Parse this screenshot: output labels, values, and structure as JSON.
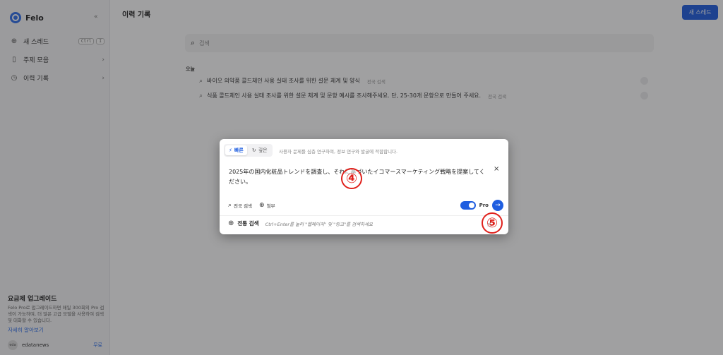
{
  "sidebar": {
    "logo": "Felo",
    "collapse_icon": "«",
    "items": [
      {
        "icon": "new-thread-icon",
        "glyph": "⊕",
        "label": "새 스레드",
        "shortcut": [
          "Ctrl",
          "I"
        ]
      },
      {
        "icon": "bookmark-icon",
        "glyph": "▯",
        "label": "주제 모음"
      },
      {
        "icon": "history-icon",
        "glyph": "◷",
        "label": "이력 기록"
      }
    ],
    "upgrade": {
      "title": "요금제 업그레이드",
      "text": "Felo Pro로 업그레이드하면 매일 300회의 Pro 검색이 가능하며, 더 많은 고급 모델을 사용하여 검색 및 대화할 수 있습니다.",
      "link": "자세히 알아보기"
    },
    "user": {
      "avatar": "eda",
      "name": "edatanews",
      "plan": "무료"
    }
  },
  "main": {
    "title": "이력 기록",
    "new_thread_button": "새 스레드",
    "search_placeholder": "검색",
    "day_label": "오늘",
    "history": [
      {
        "text": "바이오 의약품 콜드체인 사용 실태 조사를 위한 설문 체계 및 양식",
        "tag": "전국 검색"
      },
      {
        "text": "식품 콜드체인 사용 실태 조사를 위한 설문 체계 및 문항 예시를 조사해주세요. 단, 25-30개 문항으로 만들어 주세요.",
        "tag": "전국 검색"
      }
    ]
  },
  "dialog": {
    "mode_fast": "빠른",
    "mode_deep": "깊은",
    "mode_description": "사용자 문제를 심층 연구하며, 정보 연구와 발굴에 적합합니다.",
    "query": "2025年の国内化粧品トレンドを調査し、それに基づいたイコマースマーケティング戦略を提案してください。",
    "close": "×",
    "search_scope": "전국 검색",
    "attach": "첨부",
    "pro_label": "Pro",
    "send": "→",
    "footer_label": "전통 검색",
    "footer_hint": "Ctrl+Enter를 눌러 \"웹페이지\" 및 \"링크\"를 검색하세요"
  },
  "markers": {
    "step4": "④",
    "step5": "⑤"
  }
}
